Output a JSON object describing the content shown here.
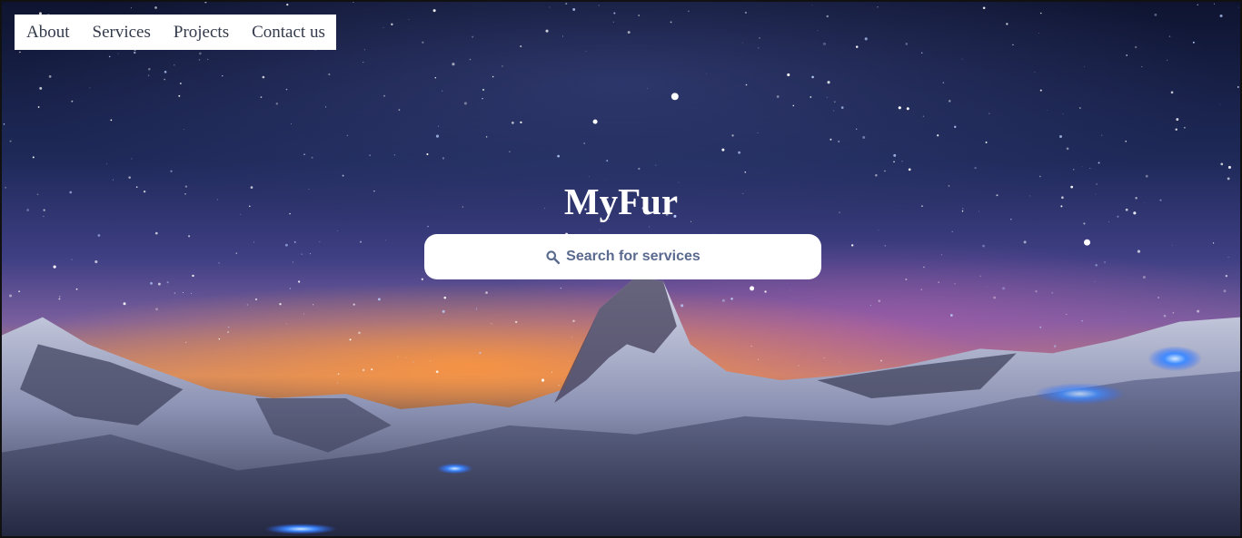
{
  "nav": {
    "items": [
      {
        "label": "About"
      },
      {
        "label": "Services"
      },
      {
        "label": "Projects"
      },
      {
        "label": "Contact us"
      }
    ]
  },
  "hero": {
    "title": "MyFur",
    "search": {
      "placeholder": "Search for services",
      "icon": "search-icon"
    }
  },
  "colors": {
    "nav_bg": "#ffffff",
    "nav_text": "#333a4a",
    "title": "#ffffff",
    "search_text": "#5a6a8e"
  }
}
